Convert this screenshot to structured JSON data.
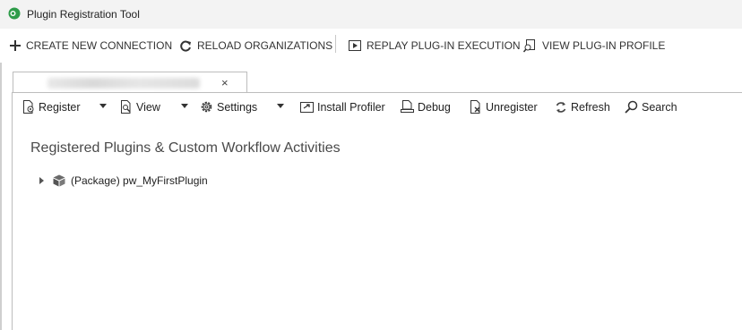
{
  "window": {
    "title": "Plugin Registration Tool"
  },
  "main_toolbar": {
    "create_connection": "CREATE NEW CONNECTION",
    "reload_organizations": "RELOAD ORGANIZATIONS",
    "replay_execution": "REPLAY PLUG-IN EXECUTION",
    "view_profile": "VIEW PLUG-IN PROFILE"
  },
  "tab": {
    "close_glyph": "×"
  },
  "sub_toolbar": {
    "register": "Register",
    "view": "View",
    "settings": "Settings",
    "install_profiler": "Install Profiler",
    "debug": "Debug",
    "unregister": "Unregister",
    "refresh": "Refresh",
    "search": "Search"
  },
  "tree": {
    "heading": "Registered Plugins & Custom Workflow Activities",
    "items": [
      {
        "label": "(Package) pw_MyFirstPlugin"
      }
    ]
  },
  "colors": {
    "logo_green": "#2e9c4a",
    "icon_gray": "#444444"
  }
}
